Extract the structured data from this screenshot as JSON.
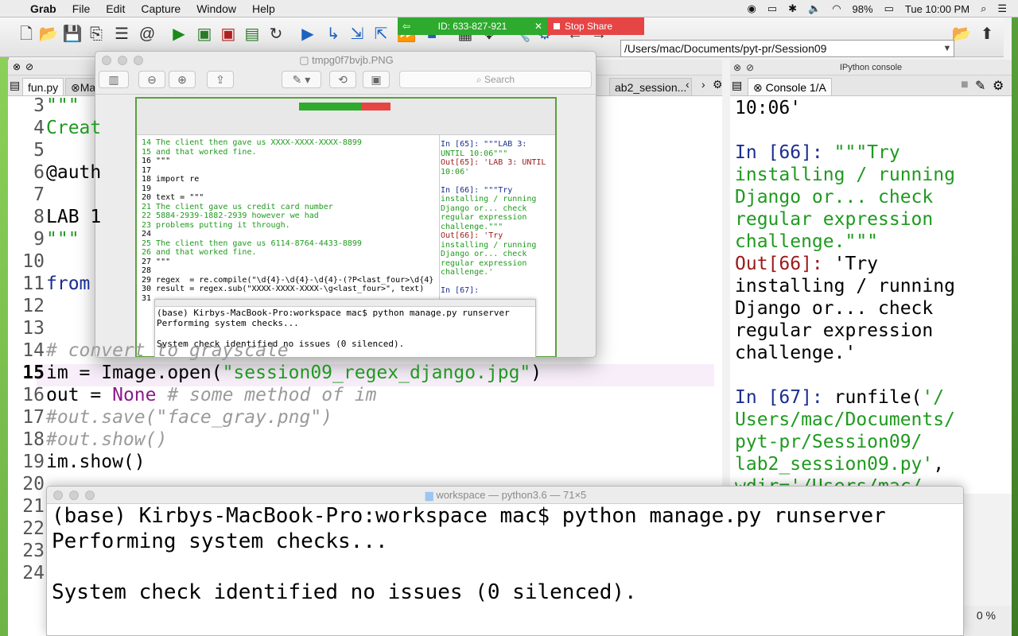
{
  "menubar": {
    "apple": "",
    "app": "Grab",
    "items": [
      "File",
      "Edit",
      "Capture",
      "Window",
      "Help"
    ],
    "battery": "98%",
    "clock": "Tue 10:00 PM"
  },
  "share": {
    "id_label": "ID: 633-827-921",
    "stop_label": "Stop Share"
  },
  "toolbar": {
    "path": "/Users/mac/Documents/pyt-pr/Session09"
  },
  "editor": {
    "tabs": [
      "fun.py",
      "Mar",
      "ab2_session..."
    ],
    "lines": [
      {
        "n": "3",
        "code": "\"\"\""
      },
      {
        "n": "4",
        "code": "Creat"
      },
      {
        "n": "5",
        "code": ""
      },
      {
        "n": "6",
        "code": "@auth"
      },
      {
        "n": "7",
        "code": ""
      },
      {
        "n": "8",
        "code": "LAB 1"
      },
      {
        "n": "9",
        "code": "\"\"\""
      },
      {
        "n": "10",
        "code": ""
      },
      {
        "n": "11",
        "code": "from "
      },
      {
        "n": "12",
        "code": ""
      },
      {
        "n": "13",
        "code": ""
      },
      {
        "n": "14",
        "code": "# convert to grayscale"
      },
      {
        "n": "15",
        "code_pre": "im = Image.open(",
        "code_str": "\"session09_regex_django.jpg\"",
        "code_post": ")"
      },
      {
        "n": "16",
        "code_pre": "out = ",
        "code_nn": "None",
        "code_cm": " # some method of im"
      },
      {
        "n": "17",
        "code": "#out.save(\"face_gray.png\")"
      },
      {
        "n": "18",
        "code": "#out.show()"
      },
      {
        "n": "19",
        "code": "im.show()"
      },
      {
        "n": "20",
        "code": ""
      },
      {
        "n": "21",
        "code": ""
      },
      {
        "n": "22",
        "code": ""
      },
      {
        "n": "23",
        "code": ""
      },
      {
        "n": "24",
        "code": ""
      }
    ]
  },
  "console": {
    "header": "IPython console",
    "tab": "Console 1/A",
    "lines": [
      {
        "t": "plain",
        "text": "10:06'"
      },
      {
        "t": "blank",
        "text": ""
      },
      {
        "t": "in",
        "prompt": "In [66]: ",
        "text": "\"\"\"Try"
      },
      {
        "t": "str",
        "text": "installing / running"
      },
      {
        "t": "str",
        "text": "Django or... check"
      },
      {
        "t": "str",
        "text": "regular expression"
      },
      {
        "t": "str",
        "text": "challenge.\"\"\""
      },
      {
        "t": "out",
        "prompt": "Out[66]: ",
        "text": "'Try"
      },
      {
        "t": "plain",
        "text": "installing / running"
      },
      {
        "t": "plain",
        "text": "Django or... check"
      },
      {
        "t": "plain",
        "text": "regular expression"
      },
      {
        "t": "plain",
        "text": "challenge.'"
      },
      {
        "t": "blank",
        "text": ""
      },
      {
        "t": "in2",
        "prompt": "In [67]: ",
        "text": "runfile(",
        "str": "'/"
      },
      {
        "t": "str",
        "text": "Users/mac/Documents/"
      },
      {
        "t": "str",
        "text": "pyt-pr/Session09/"
      },
      {
        "t": "strpost",
        "text": "lab2_session09.py'",
        "post": ","
      },
      {
        "t": "str",
        "text": "wdir='/Users/mac/"
      }
    ],
    "status": "0 %"
  },
  "preview": {
    "title": "tmpg0f7bvjb.PNG",
    "search_placeholder": "Search",
    "code_lines": [
      "14 The client then gave us XXXX-XXXX-XXXX-8899",
      "15 and that worked fine.",
      "16 \"\"\"",
      "17",
      "18 import re",
      "19",
      "20 text = \"\"\"",
      "21 The client gave us credit card number",
      "22 5884-2939-1882-2939 however we had",
      "23 problems putting it through.",
      "24",
      "25 The client then gave us 6114-8764-4433-8899",
      "26 and that worked fine.",
      "27 \"\"\"",
      "28",
      "29 regex  = re.compile(\"\\d{4}-\\d{4}-\\d{4}-(?P<last_four>\\d{4}",
      "30 result = regex.sub(\"XXXX-XXXX-XXXX-\\g<last_four>\", text)",
      "31"
    ],
    "console_lines": [
      "In [65]: \"\"\"LAB 3:",
      "UNTIL 10:06\"\"\"",
      "Out[65]: 'LAB 3: UNTIL",
      "10:06'",
      "",
      "In [66]: \"\"\"Try",
      "installing / running",
      "Django or... check",
      "regular expression",
      "challenge.\"\"\"",
      "Out[66]: 'Try",
      "installing / running",
      "Django or... check",
      "regular expression",
      "challenge.'",
      "",
      "In [67]:"
    ],
    "term_lines": [
      "(base) Kirbys-MacBook-Pro:workspace mac$ python manage.py runserver",
      "Performing system checks...",
      "",
      "System check identified no issues (0 silenced)."
    ]
  },
  "terminal": {
    "title": "workspace — python3.6 — 71×5",
    "lines": [
      "(base) Kirbys-MacBook-Pro:workspace mac$ python manage.py runserver",
      "Performing system checks...",
      "",
      "System check identified no issues (0 silenced)."
    ]
  }
}
